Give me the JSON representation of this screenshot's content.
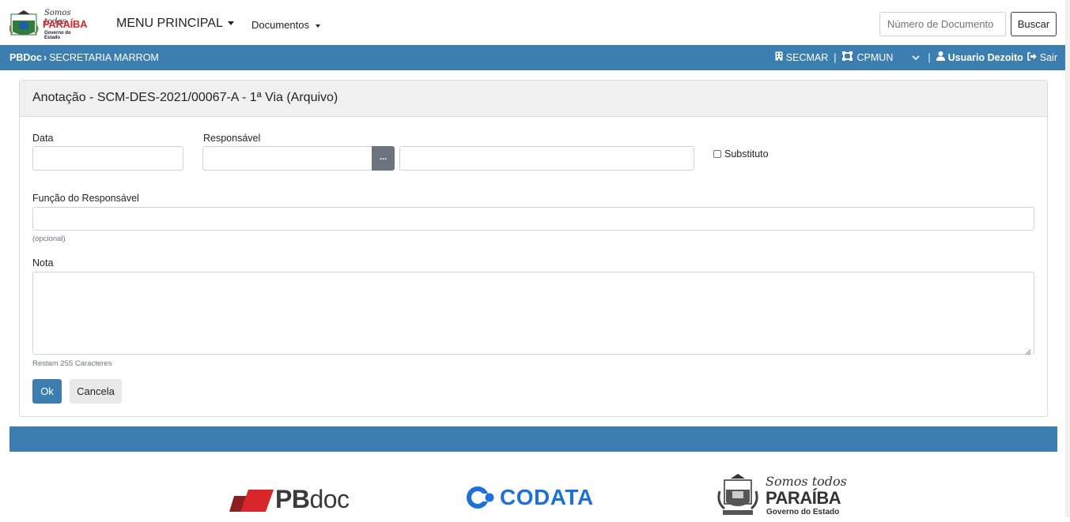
{
  "header": {
    "logo_text": {
      "line1": "Somos todos",
      "line2": "PARAÍBA",
      "line3": "Governo do Estado"
    },
    "menu_principal": "MENU PRINCIPAL",
    "menu_documentos": "Documentos",
    "search_placeholder": "Número de Documento",
    "search_button": "Buscar"
  },
  "bluebar": {
    "app_name": "PBDoc",
    "org": "SECRETARIA MARROM",
    "unit1": "SECMAR",
    "unit2": "CPMUN",
    "user": "Usuario Dezoito",
    "logout": "Sair"
  },
  "form": {
    "title": "Anotação - SCM-DES-2021/00067-A - 1ª Via (Arquivo)",
    "data_label": "Data",
    "data_value": "",
    "responsavel_label": "Responsável",
    "responsavel_code": "",
    "responsavel_name": "",
    "lookup_button": "...",
    "substituto_label": "Substituto",
    "substituto_checked": false,
    "funcao_label": "Função do Responsável",
    "funcao_value": "",
    "funcao_hint": "(opcional)",
    "nota_label": "Nota",
    "nota_value": "",
    "nota_hint": "Restam 255 Caracteres",
    "ok_button": "Ok",
    "cancel_button": "Cancela"
  },
  "footer": {
    "pbdoc_bold": "PB",
    "pbdoc_light": "doc",
    "codata": "CODATA",
    "gov_line1": "Somos todos",
    "gov_line2": "PARAÍBA",
    "gov_line3": "Governo do Estado"
  },
  "colors": {
    "primary": "#3d7eb0",
    "secondary": "#6c757d",
    "codata_blue": "#1d6fd9",
    "pbdoc_red": "#d8262b"
  }
}
